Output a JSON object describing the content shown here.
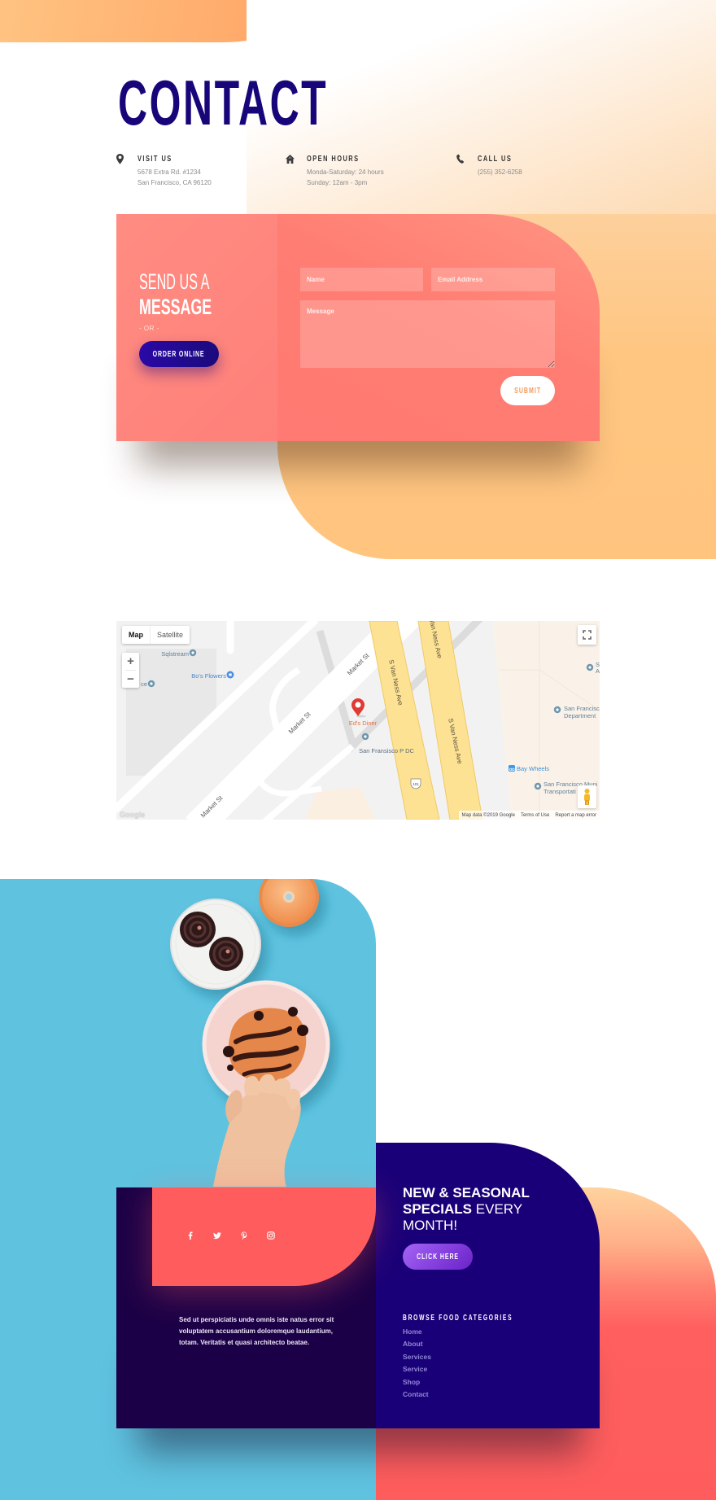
{
  "page": {
    "title": "CONTACT"
  },
  "colors": {
    "title_navy": "#17067a",
    "peach": "#ffc682",
    "orange": "#ff9b5e",
    "coral": "#ff5d5d",
    "form_coral": "#ff7d72",
    "sky_blue": "#5fc3e0",
    "deep_navy": "#1a0078",
    "dark_purple": "#1c0047",
    "button_purple": "#8742e0",
    "submit_text": "#f39c5d"
  },
  "contact_info": [
    {
      "icon": "map-pin-icon",
      "title": "VISIT US",
      "lines": [
        "5678 Extra Rd. #1234",
        "San Francisco, CA 96120"
      ]
    },
    {
      "icon": "home-icon",
      "title": "OPEN HOURS",
      "lines": [
        "Monda-Saturday: 24 hours",
        "Sunday: 12am - 3pm"
      ]
    },
    {
      "icon": "phone-icon",
      "title": "CALL US",
      "lines": [
        "(255) 352-6258"
      ]
    }
  ],
  "message_form": {
    "heading_light": "SEND US A",
    "heading_bold": "MESSAGE",
    "or_text": "- OR -",
    "order_button": "ORDER ONLINE",
    "name_placeholder": "Name",
    "email_placeholder": "Email Address",
    "message_placeholder": "Message",
    "submit_label": "SUBMIT"
  },
  "map": {
    "type_controls": [
      {
        "label": "Map",
        "selected": true
      },
      {
        "label": "Satellite",
        "selected": false
      }
    ],
    "zoom_in": "+",
    "zoom_out": "−",
    "streets": {
      "market_st": "Market St",
      "s_van_ness": "S Van Ness Ave",
      "van_ness_top": "Van Ness Ave",
      "highway": "101"
    },
    "places": {
      "sqlstream": "Sqlstream",
      "bos_flowers": "Bo's Flowers",
      "partial_left": "ce",
      "eds_diner": "Ed's Diner",
      "sf_pdc": "San Fransisco P DC",
      "sf_department": [
        "San Francisc",
        "Department"
      ],
      "bay_wheels": "Bay Wheels",
      "sf_muni": [
        "San Francisco Muni",
        "Transportati"
      ],
      "partial_right": [
        "S",
        "A"
      ]
    },
    "footer": {
      "logo": "Google",
      "map_data": "Map data ©2019 Google",
      "terms": "Terms of Use",
      "report": "Report a map error"
    }
  },
  "promo": {
    "heading_bold_1": "NEW & SEASONAL",
    "heading_bold_2": "SPECIALS",
    "heading_light_1": "EVERY",
    "heading_light_2": "MONTH!",
    "button": "CLICK HERE",
    "categories_title": "BROWSE FOOD CATEGORIES",
    "categories": [
      "Home",
      "About",
      "Services",
      "Service",
      "Shop",
      "Contact"
    ]
  },
  "footer_card": {
    "social": [
      {
        "name": "facebook",
        "icon": "facebook-icon"
      },
      {
        "name": "twitter",
        "icon": "twitter-icon"
      },
      {
        "name": "pinterest",
        "icon": "pinterest-icon"
      },
      {
        "name": "instagram",
        "icon": "instagram-icon"
      }
    ],
    "text": "Sed ut perspiciatis unde omnis iste natus error sit voluptatem accusantium doloremque laudantium, totam. Veritatis et quasi architecto beatae."
  }
}
